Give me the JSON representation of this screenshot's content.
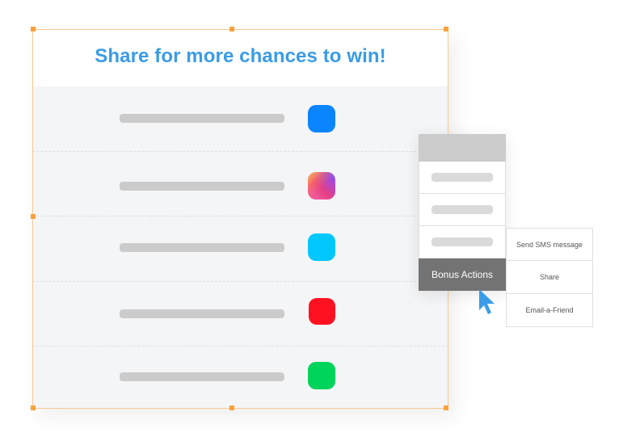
{
  "widget": {
    "title": "Share for more chances to win!",
    "rows": [
      {
        "icon": "messenger-icon",
        "color": "#0a84ff"
      },
      {
        "icon": "instagram-icon",
        "color": "gradient"
      },
      {
        "icon": "twitter-icon",
        "color": "#00c8ff"
      },
      {
        "icon": "pinterest-icon",
        "color": "#ff1122"
      },
      {
        "icon": "whatsapp-icon",
        "color": "#00d45a"
      }
    ]
  },
  "menu": {
    "active_label": "Bonus Actions",
    "submenu": [
      "Send SMS message",
      "Share",
      "Email-a-Friend"
    ]
  },
  "colors": {
    "accent": "#3a9ce6",
    "selection": "#f7a13a",
    "cursor": "#3a9ce6"
  }
}
